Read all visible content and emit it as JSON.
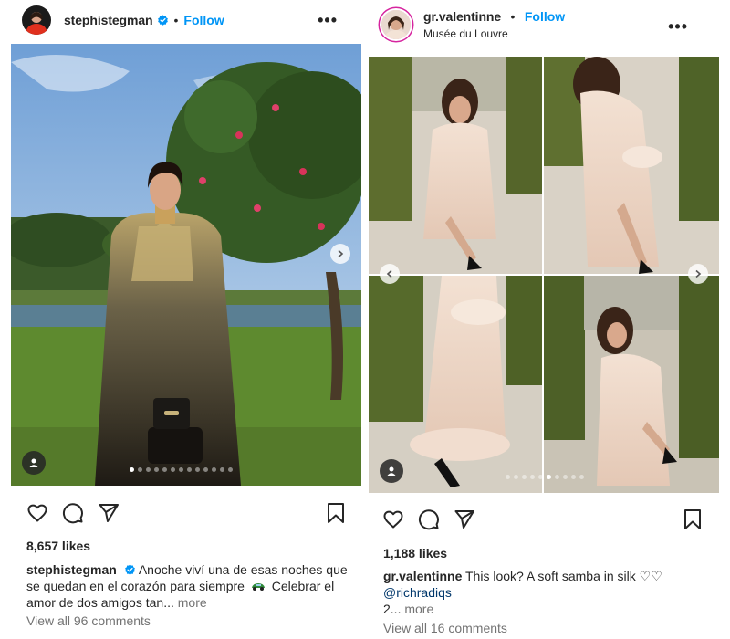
{
  "posts": [
    {
      "username": "stephistegman",
      "verified": true,
      "follow_label": "Follow",
      "separator": "•",
      "likes": "8,657 likes",
      "caption_user": "stephistegman",
      "caption_text": "Anoche viví una de esas noches que se quedan en el corazón para siempre",
      "caption_tail": "Celebrar el amor de dos amigos tan...",
      "more_label": "more",
      "comments": "View all 96 comments",
      "carousel_dots": 13,
      "active_dot": 0
    },
    {
      "username": "gr.valentinne",
      "verified": false,
      "follow_label": "Follow",
      "separator": "•",
      "location": "Musée du Louvre",
      "likes": "1,188 likes",
      "caption_user": "gr.valentinne",
      "caption_text": "This look? A soft samba in silk ♡♡",
      "mention": "@richradiqs",
      "caption_tail": "2...",
      "more_label": "more",
      "comments": "View all 16 comments",
      "carousel_dots": 10,
      "active_dot": 5
    }
  ],
  "icons": {
    "more": "more-options-icon",
    "like": "heart-icon",
    "comment": "comment-icon",
    "share": "share-icon",
    "save": "bookmark-icon",
    "verified": "verified-badge-icon",
    "tag": "user-tag-icon",
    "next": "chevron-right-icon",
    "prev": "chevron-left-icon"
  },
  "colors": {
    "follow": "#0095f6",
    "verified": "#0095f6",
    "text": "#262626",
    "muted": "#737373",
    "mention": "#00376b"
  }
}
